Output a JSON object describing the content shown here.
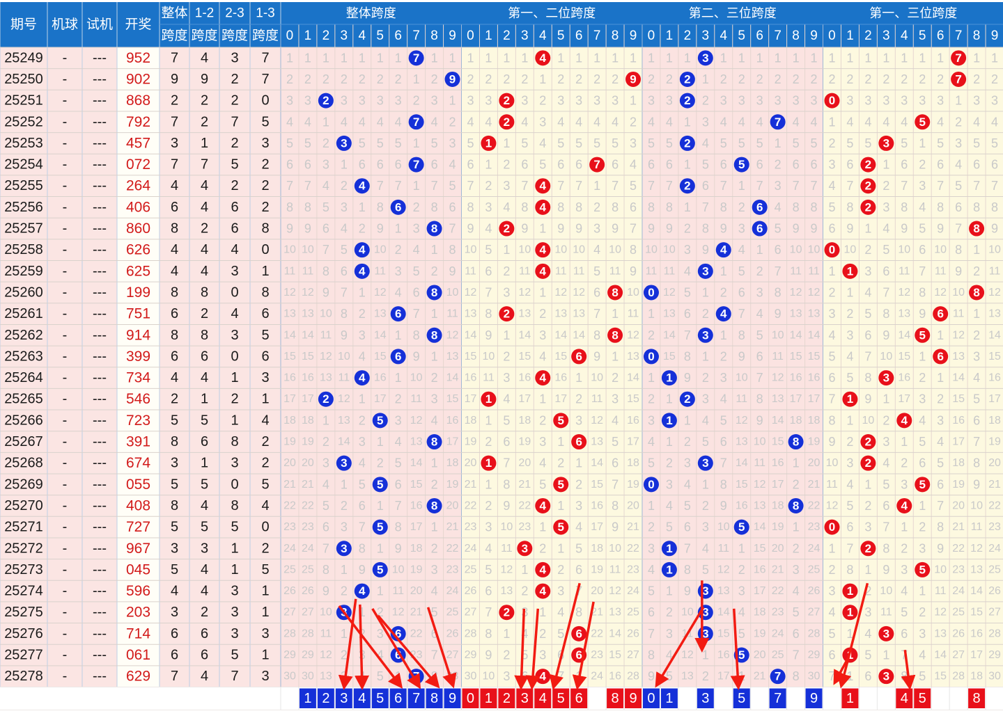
{
  "header": {
    "issue": "期号",
    "machine": "机球",
    "trial": "试机",
    "draw": "开奖",
    "span_all": [
      "整体",
      "跨度"
    ],
    "span_12": [
      "1-2",
      "跨度"
    ],
    "span_23": [
      "2-3",
      "跨度"
    ],
    "span_13": [
      "1-3",
      "跨度"
    ],
    "sections": [
      "整体跨度",
      "第一、二位跨度",
      "第二、三位跨度",
      "第一、三位跨度"
    ]
  },
  "digits": [
    0,
    1,
    2,
    3,
    4,
    5,
    6,
    7,
    8,
    9
  ],
  "colors": {
    "header_bg": "#1a73c8",
    "header_text": "#ffffff",
    "blue_ball": "#1530d8",
    "red_ball": "#e8101a",
    "draw_red": "#d21a1a",
    "row_pink": "#fbe5e3",
    "row_white": "#fffef7",
    "section_pink": "#fbe3e1",
    "section_cream": "#fdf9e0",
    "miss_text": "#c9c9c9",
    "arrow": "#f21b12"
  },
  "chart_data": {
    "type": "table",
    "rows": [
      {
        "issue": "25249",
        "machine": "-",
        "trial": "---",
        "draw": "952",
        "span": 7,
        "s12": 4,
        "s23": 3,
        "s13": 7
      },
      {
        "issue": "25250",
        "machine": "-",
        "trial": "---",
        "draw": "902",
        "span": 9,
        "s12": 9,
        "s23": 2,
        "s13": 7
      },
      {
        "issue": "25251",
        "machine": "-",
        "trial": "---",
        "draw": "868",
        "span": 2,
        "s12": 2,
        "s23": 2,
        "s13": 0
      },
      {
        "issue": "25252",
        "machine": "-",
        "trial": "---",
        "draw": "792",
        "span": 7,
        "s12": 2,
        "s23": 7,
        "s13": 5
      },
      {
        "issue": "25253",
        "machine": "-",
        "trial": "---",
        "draw": "457",
        "span": 3,
        "s12": 1,
        "s23": 2,
        "s13": 3
      },
      {
        "issue": "25254",
        "machine": "-",
        "trial": "---",
        "draw": "072",
        "span": 7,
        "s12": 7,
        "s23": 5,
        "s13": 2
      },
      {
        "issue": "25255",
        "machine": "-",
        "trial": "---",
        "draw": "264",
        "span": 4,
        "s12": 4,
        "s23": 2,
        "s13": 2
      },
      {
        "issue": "25256",
        "machine": "-",
        "trial": "---",
        "draw": "406",
        "span": 6,
        "s12": 4,
        "s23": 6,
        "s13": 2
      },
      {
        "issue": "25257",
        "machine": "-",
        "trial": "---",
        "draw": "860",
        "span": 8,
        "s12": 2,
        "s23": 6,
        "s13": 8
      },
      {
        "issue": "25258",
        "machine": "-",
        "trial": "---",
        "draw": "626",
        "span": 4,
        "s12": 4,
        "s23": 4,
        "s13": 0
      },
      {
        "issue": "25259",
        "machine": "-",
        "trial": "---",
        "draw": "625",
        "span": 4,
        "s12": 4,
        "s23": 3,
        "s13": 1
      },
      {
        "issue": "25260",
        "machine": "-",
        "trial": "---",
        "draw": "199",
        "span": 8,
        "s12": 8,
        "s23": 0,
        "s13": 8
      },
      {
        "issue": "25261",
        "machine": "-",
        "trial": "---",
        "draw": "751",
        "span": 6,
        "s12": 2,
        "s23": 4,
        "s13": 6
      },
      {
        "issue": "25262",
        "machine": "-",
        "trial": "---",
        "draw": "914",
        "span": 8,
        "s12": 8,
        "s23": 3,
        "s13": 5
      },
      {
        "issue": "25263",
        "machine": "-",
        "trial": "---",
        "draw": "399",
        "span": 6,
        "s12": 6,
        "s23": 0,
        "s13": 6
      },
      {
        "issue": "25264",
        "machine": "-",
        "trial": "---",
        "draw": "734",
        "span": 4,
        "s12": 4,
        "s23": 1,
        "s13": 3
      },
      {
        "issue": "25265",
        "machine": "-",
        "trial": "---",
        "draw": "546",
        "span": 2,
        "s12": 1,
        "s23": 2,
        "s13": 1
      },
      {
        "issue": "25266",
        "machine": "-",
        "trial": "---",
        "draw": "723",
        "span": 5,
        "s12": 5,
        "s23": 1,
        "s13": 4
      },
      {
        "issue": "25267",
        "machine": "-",
        "trial": "---",
        "draw": "391",
        "span": 8,
        "s12": 6,
        "s23": 8,
        "s13": 2
      },
      {
        "issue": "25268",
        "machine": "-",
        "trial": "---",
        "draw": "674",
        "span": 3,
        "s12": 1,
        "s23": 3,
        "s13": 2
      },
      {
        "issue": "25269",
        "machine": "-",
        "trial": "---",
        "draw": "055",
        "span": 5,
        "s12": 5,
        "s23": 0,
        "s13": 5
      },
      {
        "issue": "25270",
        "machine": "-",
        "trial": "---",
        "draw": "408",
        "span": 8,
        "s12": 4,
        "s23": 8,
        "s13": 4
      },
      {
        "issue": "25271",
        "machine": "-",
        "trial": "---",
        "draw": "727",
        "span": 5,
        "s12": 5,
        "s23": 5,
        "s13": 0
      },
      {
        "issue": "25272",
        "machine": "-",
        "trial": "---",
        "draw": "967",
        "span": 3,
        "s12": 3,
        "s23": 1,
        "s13": 2
      },
      {
        "issue": "25273",
        "machine": "-",
        "trial": "---",
        "draw": "045",
        "span": 5,
        "s12": 4,
        "s23": 1,
        "s13": 5
      },
      {
        "issue": "25274",
        "machine": "-",
        "trial": "---",
        "draw": "596",
        "span": 4,
        "s12": 4,
        "s23": 3,
        "s13": 1
      },
      {
        "issue": "25275",
        "machine": "-",
        "trial": "---",
        "draw": "203",
        "span": 3,
        "s12": 2,
        "s23": 3,
        "s13": 1
      },
      {
        "issue": "25276",
        "machine": "-",
        "trial": "---",
        "draw": "714",
        "span": 6,
        "s12": 6,
        "s23": 3,
        "s13": 3
      },
      {
        "issue": "25277",
        "machine": "-",
        "trial": "---",
        "draw": "061",
        "span": 6,
        "s12": 6,
        "s23": 5,
        "s13": 1
      },
      {
        "issue": "25278",
        "machine": "-",
        "trial": "---",
        "draw": "629",
        "span": 7,
        "s12": 4,
        "s23": 7,
        "s13": 3
      }
    ],
    "predictions": {
      "span_all": [
        1,
        2,
        3,
        4,
        5,
        6,
        7,
        8,
        9
      ],
      "span_12": [
        0,
        1,
        2,
        3,
        4,
        5,
        6,
        8,
        9
      ],
      "span_23": [
        0,
        1,
        3,
        5,
        7,
        9
      ],
      "span_13": [
        1,
        4,
        5,
        8
      ]
    }
  }
}
